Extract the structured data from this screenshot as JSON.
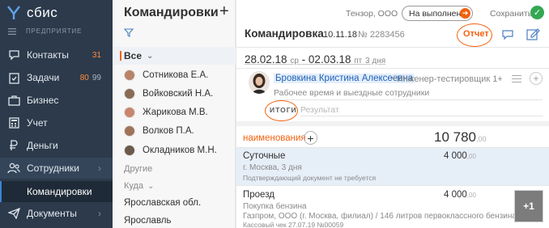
{
  "app": {
    "logo_text": "сбис"
  },
  "nav": {
    "section": "ПРЕДПРИЯТИЕ",
    "items": [
      {
        "label": "Контакты",
        "count": "31"
      },
      {
        "label": "Задачи",
        "count": "80",
        "count2": "99"
      },
      {
        "label": "Бизнес"
      },
      {
        "label": "Учет"
      },
      {
        "label": "Деньги"
      },
      {
        "label": "Сотрудники"
      },
      {
        "label": "Командировки"
      },
      {
        "label": "Документы"
      }
    ]
  },
  "list": {
    "title": "Командировки",
    "add": "+",
    "all_label": "Все",
    "people": [
      "Сотникова Е.А.",
      "Войковский Н.А.",
      "Жарикова М.В.",
      "Волков П.А.",
      "Окладников М.Н."
    ],
    "other_label": "Другие",
    "where_label": "Куда",
    "places": [
      "Ярославская обл.",
      "Ярославль"
    ]
  },
  "card": {
    "org": "Тензор, ООО",
    "status": "На выполнение",
    "save_label": "Сохранить",
    "title": "Командировка",
    "date": "10.11.18",
    "number": "№ 2283456",
    "report": "Отчет",
    "period": {
      "from": "28.02.18",
      "from_day": "ср",
      "dash": "-",
      "to": "02.03.18",
      "to_day": "пт",
      "days": "3 дня"
    },
    "employee": {
      "name": "Бровкина Кристина Алексеевна",
      "remove": "×",
      "position": "Инженер-тестировщик 1+ ка",
      "schedule": "Рабочее время и выездные сотрудники"
    },
    "totals_tab": "ИТОГИ",
    "result_placeholder": "Результат",
    "expenses": {
      "column": "наименования",
      "total": "10 780",
      "total_kop": ",00",
      "rows": [
        {
          "title": "Суточные",
          "sub": "г. Москва, 3 дня",
          "note": "Подтверждающий документ не требуется",
          "amount": "4 000",
          "kop": ",00"
        },
        {
          "title": "Проезд",
          "sub": "Покупка бензина",
          "note_main": "Газпром, ООО (г. Москва, филиал) / 146 литров первоклассного бензина",
          "note": "Кассовый чек 27.07.19  №00059",
          "amount": "4 000",
          "kop": ",00",
          "attachments": "+1"
        }
      ]
    }
  },
  "colors": {
    "accent": "#f3620e",
    "nav_bg": "#2c3a4b",
    "link": "#1f63b5",
    "ok": "#33a853"
  }
}
